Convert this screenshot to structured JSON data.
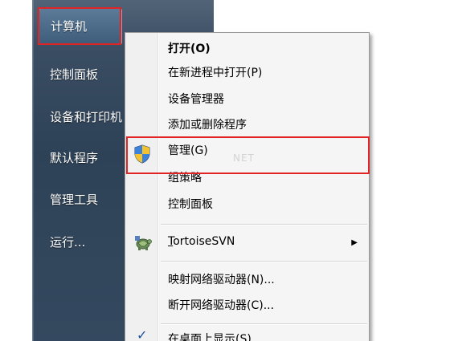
{
  "start_menu": {
    "items": [
      {
        "label": "计算机"
      },
      {
        "label": "控制面板"
      },
      {
        "label": "设备和打印机"
      },
      {
        "label": "默认程序"
      },
      {
        "label": "管理工具"
      },
      {
        "label": "运行..."
      }
    ]
  },
  "context_menu": {
    "items": [
      {
        "label_main": "打开",
        "label_key": "(O)"
      },
      {
        "label_main": "在新进程中打开",
        "label_key": "(P)"
      },
      {
        "label_main": "设备管理器"
      },
      {
        "label_main": "添加或删除程序"
      },
      {
        "label_main": "管理",
        "label_key": "(G)"
      },
      {
        "label_main": "组策略"
      },
      {
        "label_main": "控制面板"
      },
      {
        "label_first": "T",
        "label_rest": "ortoiseSVN"
      },
      {
        "label_main": "映射网络驱动器",
        "label_key": "(N)..."
      },
      {
        "label_main": "断开网络驱动器",
        "label_key": "(C)..."
      },
      {
        "label_main": "在桌面上显示",
        "label_key": "(S)"
      }
    ],
    "submenu_arrow": "▶"
  },
  "icons": {
    "manage": "shield-icon",
    "tortoise": "tortoisesvn-icon",
    "check": "checkmark-icon"
  },
  "colors": {
    "highlight_border": "#e02424",
    "start_menu_bg": "#2e4257",
    "menu_bg": "#f5f5f5"
  },
  "watermark": "NET"
}
